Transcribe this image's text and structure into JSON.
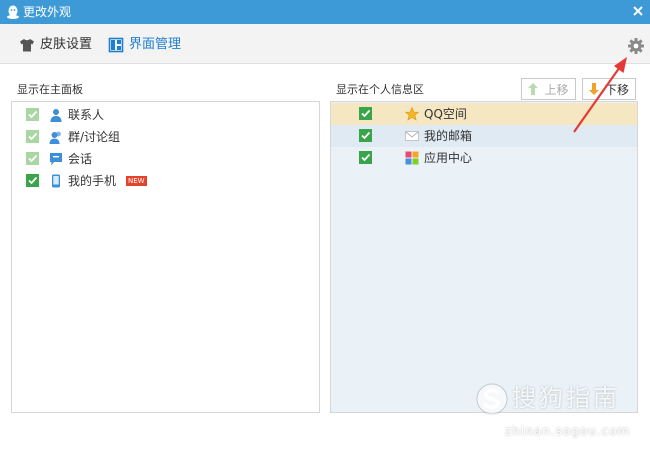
{
  "window": {
    "title": "更改外观"
  },
  "toolbar": {
    "tabs": [
      {
        "label": "皮肤设置"
      },
      {
        "label": "界面管理"
      }
    ]
  },
  "left_panel": {
    "label": "显示在主面板",
    "items": [
      {
        "label": "联系人",
        "icon": "contacts-icon",
        "checked": true,
        "locked": true
      },
      {
        "label": "群/讨论组",
        "icon": "group-icon",
        "checked": true,
        "locked": true
      },
      {
        "label": "会话",
        "icon": "chat-icon",
        "checked": true,
        "locked": true
      },
      {
        "label": "我的手机",
        "icon": "phone-icon",
        "checked": true,
        "locked": false,
        "badge": "NEW"
      }
    ]
  },
  "right_panel": {
    "label": "显示在个人信息区",
    "move_up_label": "上移",
    "move_down_label": "下移",
    "items": [
      {
        "label": "QQ空间",
        "icon": "star-icon",
        "checked": true,
        "selected": true
      },
      {
        "label": "我的邮箱",
        "icon": "mail-icon",
        "checked": true,
        "selected": false
      },
      {
        "label": "应用中心",
        "icon": "app-center-icon",
        "checked": true,
        "selected": false
      }
    ]
  },
  "watermark": {
    "text": "搜狗指南",
    "url": "zhinan.sogou.com"
  },
  "colors": {
    "titlebar": "#3e9ad6",
    "active_tab": "#1f7fcf",
    "checkbox_green": "#3aa44a",
    "checkbox_locked": "#a9d6a3",
    "selected_row": "#f6e7c3",
    "right_panel_bg": "#eaf2f8",
    "annotation_arrow": "#e53935"
  }
}
